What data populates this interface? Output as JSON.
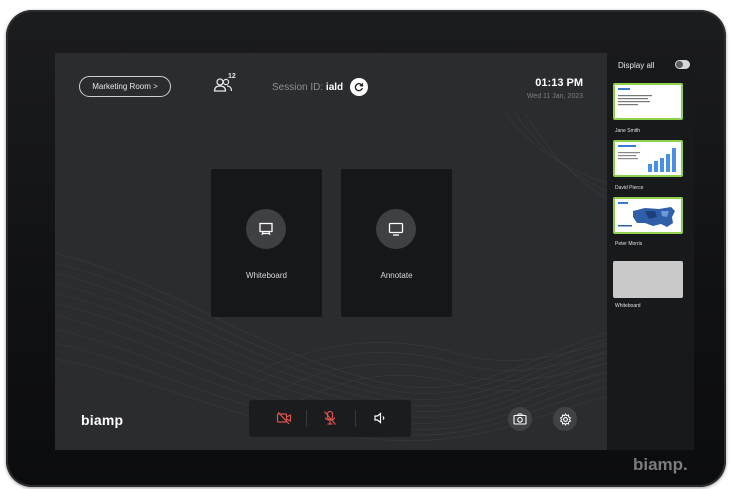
{
  "header": {
    "room_button": "Marketing Room >",
    "participant_count": "12",
    "session_prefix": "Session ID:",
    "session_id": "iald",
    "time": "01:13 PM",
    "date": "Wed 11 Jan, 2023"
  },
  "tiles": [
    {
      "label": "Whiteboard",
      "icon": "whiteboard-icon"
    },
    {
      "label": "Annotate",
      "icon": "monitor-icon"
    }
  ],
  "footer": {
    "logo": "biamp",
    "controls": [
      {
        "name": "camera-off",
        "state": "muted",
        "icon": "video-off-icon"
      },
      {
        "name": "mic-off",
        "state": "muted",
        "icon": "mic-off-icon"
      },
      {
        "name": "volume",
        "state": "on",
        "icon": "speaker-icon"
      }
    ],
    "actions": [
      {
        "name": "screenshot",
        "icon": "camera-icon"
      },
      {
        "name": "settings",
        "icon": "gear-icon"
      }
    ]
  },
  "sidebar": {
    "display_all_label": "Display all",
    "display_all_on": false,
    "presenters": [
      {
        "name": "Jane Smith",
        "active": true
      },
      {
        "name": "David Pierce",
        "active": true
      },
      {
        "name": "Peter Morris",
        "active": true
      },
      {
        "name": "Whiteboard",
        "active": false
      }
    ]
  },
  "device_brand": "biamp.",
  "colors": {
    "screen_bg": "#2b2c2f",
    "tile_bg": "#161719",
    "accent_green": "#8fd14f",
    "muted_red": "#d9534f"
  }
}
